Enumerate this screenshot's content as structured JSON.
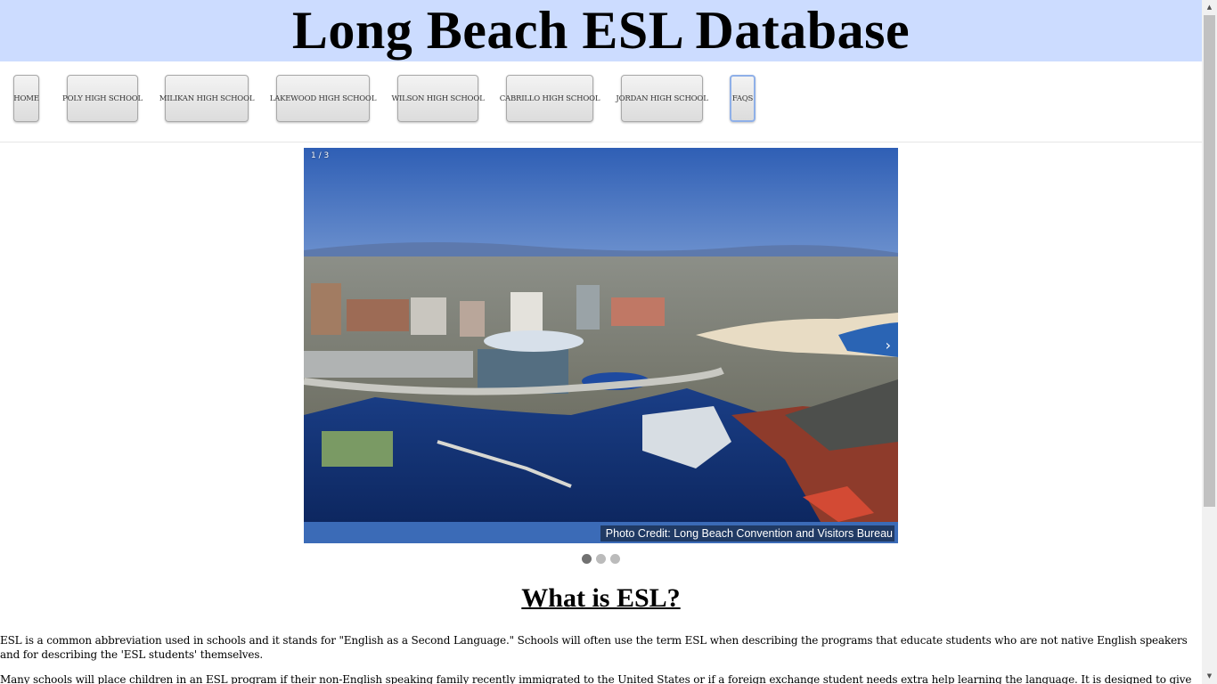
{
  "header": {
    "title": "Long Beach ESL Database"
  },
  "nav": {
    "items": [
      {
        "label": "HOME"
      },
      {
        "label": "POLY HIGH SCHOOL"
      },
      {
        "label": "MILIKAN HIGH SCHOOL"
      },
      {
        "label": "LAKEWOOD HIGH SCHOOL"
      },
      {
        "label": "WILSON HIGH SCHOOL"
      },
      {
        "label": "CABRILLO HIGH SCHOOL"
      },
      {
        "label": "JORDAN HIGH SCHOOL"
      },
      {
        "label": "FAQS"
      }
    ],
    "focused_item": "FAQS"
  },
  "slideshow": {
    "counter": "1 / 3",
    "current_slide": 1,
    "total_slides": 3,
    "caption": "Photo Credit: Long Beach Convention and Visitors Bureau",
    "next_icon": "chevron-right-icon",
    "active_dot_color": "#717171",
    "inactive_dot_color": "#bbbbbb"
  },
  "content": {
    "heading": "What is ESL?",
    "paragraph1": "ESL is a common abbreviation used in schools and it stands for \"English as a Second Language.\" Schools will often use the term ESL when describing the programs that educate students who are not native English speakers and for describing the 'ESL students' themselves.",
    "paragraph2": "Many schools will place children in an ESL program if their non-English speaking family recently immigrated to the United States or if a foreign exchange student needs extra help learning the language. It is designed to give these children"
  },
  "colors": {
    "header_background": "#ccdcff",
    "page_background": "#ffffff",
    "text": "#000000"
  }
}
